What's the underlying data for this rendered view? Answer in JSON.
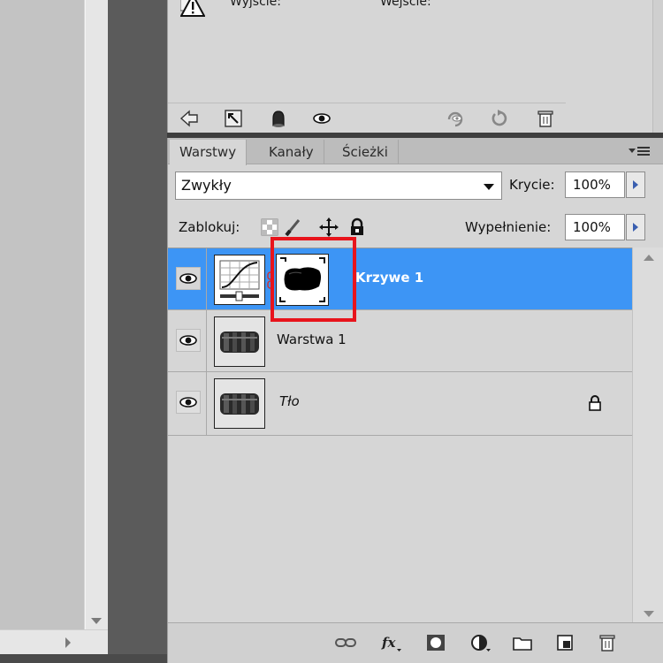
{
  "curves_panel": {
    "output_label": "Wyjście:",
    "input_label": "Wejście:"
  },
  "tabs": [
    {
      "label": "Warstwy",
      "active": true
    },
    {
      "label": "Kanały",
      "active": false
    },
    {
      "label": "Ścieżki",
      "active": false
    }
  ],
  "blend": {
    "mode": "Zwykły",
    "opacity_label": "Krycie:",
    "opacity_value": "100%"
  },
  "lock": {
    "label": "Zablokuj:",
    "fill_label": "Wypełnienie:",
    "fill_value": "100%"
  },
  "layers": [
    {
      "name": "Krzywe 1",
      "selected": true,
      "italic": false,
      "locked": false,
      "type": "curves-adjustment"
    },
    {
      "name": "Warstwa 1",
      "selected": false,
      "italic": false,
      "locked": false,
      "type": "image"
    },
    {
      "name": "Tło",
      "selected": false,
      "italic": true,
      "locked": true,
      "type": "image"
    }
  ],
  "colors": {
    "selection": "#3d95f5",
    "highlight_box": "#e8141c",
    "panel_bg": "#d6d6d6"
  }
}
